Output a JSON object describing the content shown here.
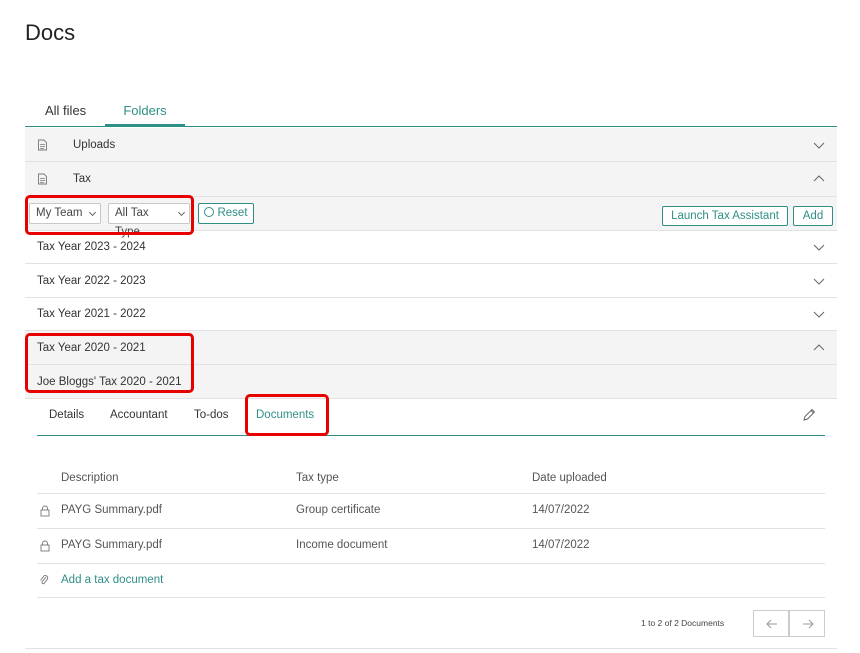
{
  "page": {
    "title": "Docs"
  },
  "main_tabs": [
    {
      "label": "All files",
      "active": false
    },
    {
      "label": "Folders",
      "active": true
    }
  ],
  "folders": [
    {
      "label": "Uploads",
      "expanded": false
    },
    {
      "label": "Tax",
      "expanded": true
    }
  ],
  "filters": {
    "team": "My Team",
    "tax_type": "All Tax Type",
    "reset_label": "Reset",
    "launch_label": "Launch Tax Assistant",
    "add_label": "Add"
  },
  "tax_years": [
    {
      "label": "Tax Year 2023 - 2024",
      "expanded": false
    },
    {
      "label": "Tax Year 2022 - 2023",
      "expanded": false
    },
    {
      "label": "Tax Year 2021 - 2022",
      "expanded": false
    },
    {
      "label": "Tax Year 2020 - 2021",
      "expanded": true
    }
  ],
  "tax_return": {
    "label": "Joe Bloggs' Tax 2020 - 2021"
  },
  "sub_tabs": [
    {
      "label": "Details",
      "active": false
    },
    {
      "label": "Accountant",
      "active": false
    },
    {
      "label": "To-dos",
      "active": false
    },
    {
      "label": "Documents",
      "active": true
    }
  ],
  "table": {
    "headers": [
      "Description",
      "Tax type",
      "Date uploaded"
    ],
    "rows": [
      {
        "description": "PAYG Summary.pdf",
        "tax_type": "Group certificate",
        "date": "14/07/2022"
      },
      {
        "description": "PAYG Summary.pdf",
        "tax_type": "Income document",
        "date": "14/07/2022"
      }
    ],
    "add_label": "Add a tax document"
  },
  "pagination": {
    "summary": "1 to 2 of 2 Documents"
  },
  "colors": {
    "accent": "#2f8f87",
    "highlight": "#e60000"
  },
  "icons": {
    "folder": "document-icon",
    "lock": "lock-icon",
    "attach": "paperclip-icon",
    "edit": "pencil-icon"
  }
}
